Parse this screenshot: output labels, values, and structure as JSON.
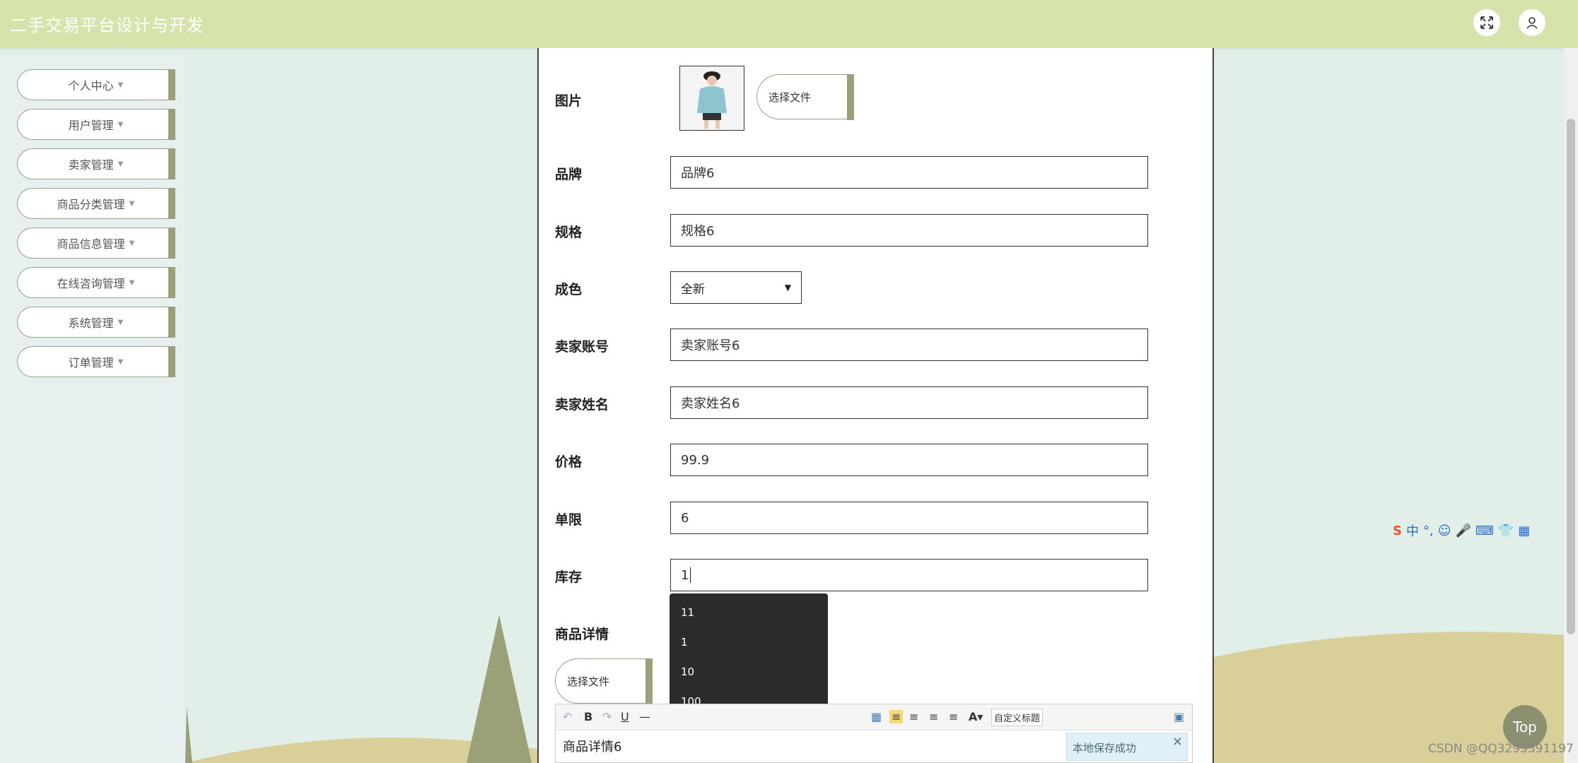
{
  "header": {
    "app_title": "二手交易平台设计与开发"
  },
  "sidebar": {
    "items": [
      {
        "label": "个人中心"
      },
      {
        "label": "用户管理"
      },
      {
        "label": "卖家管理"
      },
      {
        "label": "商品分类管理"
      },
      {
        "label": "商品信息管理"
      },
      {
        "label": "在线咨询管理"
      },
      {
        "label": "系统管理"
      },
      {
        "label": "订单管理"
      }
    ]
  },
  "form": {
    "image_label": "图片",
    "choose_file_label": "选择文件",
    "brand_label": "品牌",
    "brand_value": "品牌6",
    "spec_label": "规格",
    "spec_value": "规格6",
    "condition_label": "成色",
    "condition_value": "全新",
    "seller_account_label": "卖家账号",
    "seller_account_value": "卖家账号6",
    "seller_name_label": "卖家姓名",
    "seller_name_value": "卖家姓名6",
    "price_label": "价格",
    "price_value": "99.9",
    "limit_label": "单限",
    "limit_value": "6",
    "stock_label": "库存",
    "stock_value": "1",
    "detail_label": "商品详情",
    "detail_file_label": "选择文件",
    "autocomplete_options": [
      "11",
      "1",
      "10",
      "100"
    ],
    "editor_content": "商品详情6",
    "editor_custom_title": "自定义标题",
    "save_note": "本地保存成功"
  },
  "top_button": "Top",
  "watermark": "CSDN @QQ3295391197"
}
